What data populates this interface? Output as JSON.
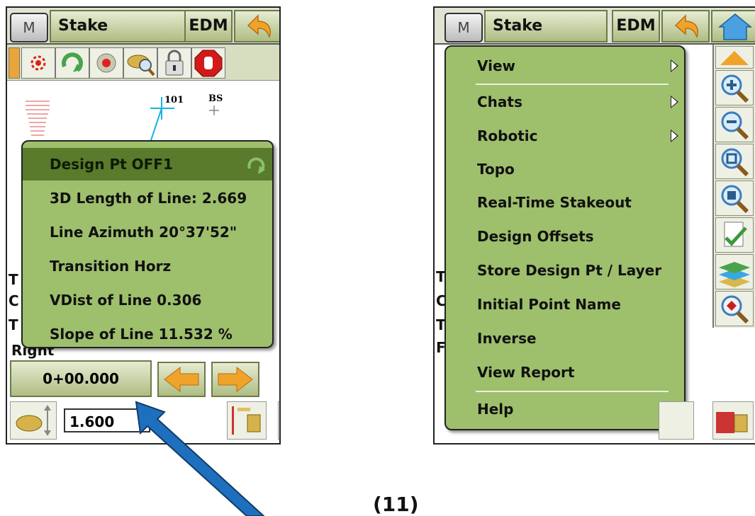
{
  "left": {
    "title": "Stake",
    "edm": "EDM",
    "m_label": "M",
    "map_labels": {
      "point": "101",
      "bs": "BS"
    },
    "side_letters": [
      "T",
      "C",
      "T"
    ],
    "bottom_word": "Right",
    "station": "0+00.000",
    "height_value": "1.600",
    "popup": {
      "items": [
        "Design Pt OFF1",
        "3D Length of Line:  2.669",
        "Line Azimuth 20°37'52\"",
        "Transition Horz",
        "VDist of Line 0.306",
        "Slope of Line 11.532 %"
      ]
    }
  },
  "right": {
    "title": "Stake",
    "edm": "EDM",
    "m_label": "M",
    "side_letters": [
      "T",
      "C",
      "T",
      "F"
    ],
    "menu": [
      {
        "label": "View",
        "submenu": true
      },
      {
        "label": "Chats",
        "submenu": true
      },
      {
        "label": "Robotic",
        "submenu": true
      },
      {
        "label": "Topo",
        "submenu": false
      },
      {
        "label": "Real-Time Stakeout",
        "submenu": false
      },
      {
        "label": "Design Offsets",
        "submenu": false
      },
      {
        "label": "Store Design Pt / Layer",
        "submenu": false
      },
      {
        "label": "Initial Point Name",
        "submenu": false
      },
      {
        "label": "Inverse",
        "submenu": false
      },
      {
        "label": "View Report",
        "submenu": false
      },
      {
        "label": "Help",
        "submenu": false
      }
    ]
  },
  "caption": "(11)",
  "colors": {
    "popup_green": "#9ebf6c",
    "highlight_green": "#5a7a2c",
    "arrow_blue": "#1f6fbf"
  }
}
